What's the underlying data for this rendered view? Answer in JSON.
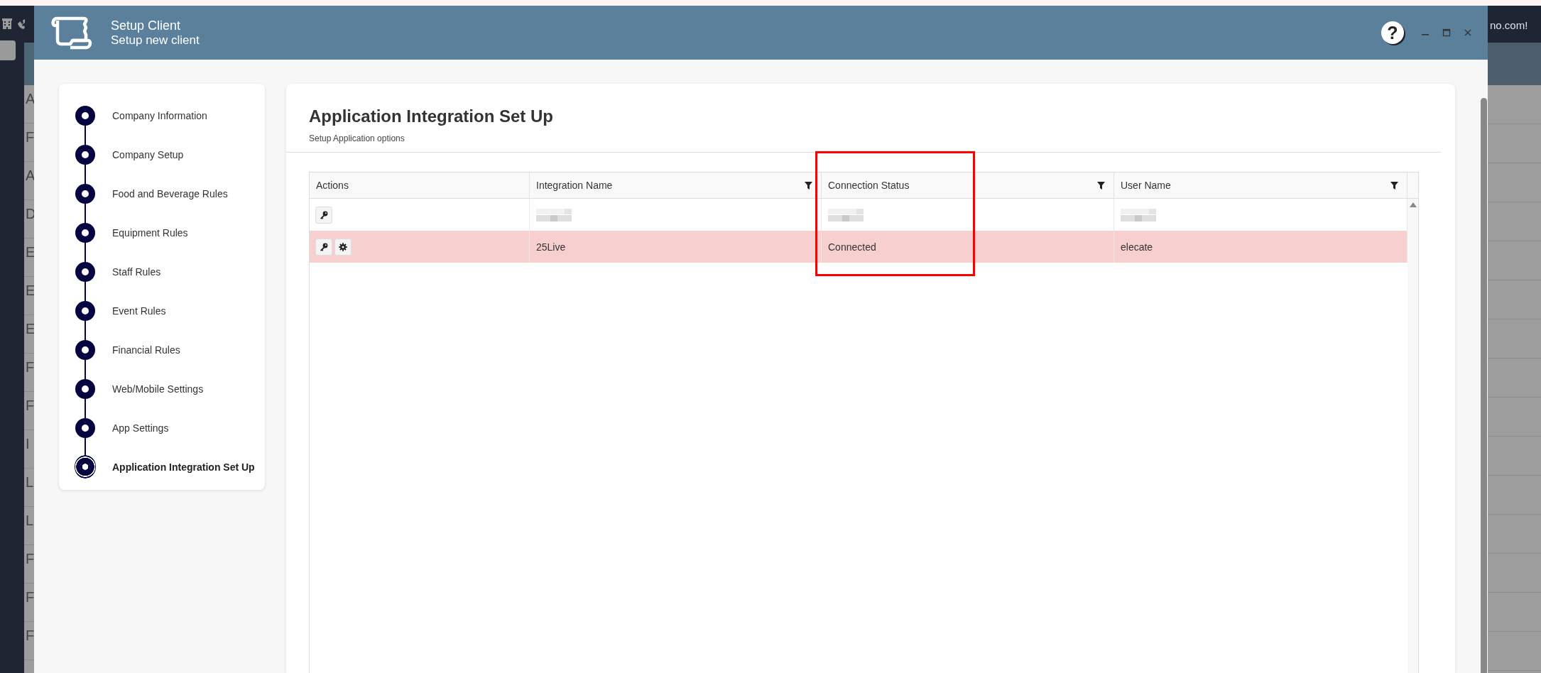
{
  "background": {
    "list_letters": [
      "A",
      "F",
      "A",
      "D",
      "E",
      "E",
      "E",
      "F",
      "F",
      "I",
      "L",
      "L",
      "F",
      "F",
      "F"
    ],
    "top_right_text": "no.com!"
  },
  "window": {
    "title": "Setup Client",
    "subtitle": "Setup new client",
    "help": "?"
  },
  "steps": [
    {
      "label": "Company Information",
      "selected": false
    },
    {
      "label": "Company Setup",
      "selected": false
    },
    {
      "label": "Food and Beverage Rules",
      "selected": false
    },
    {
      "label": "Equipment Rules",
      "selected": false
    },
    {
      "label": "Staff Rules",
      "selected": false
    },
    {
      "label": "Event Rules",
      "selected": false
    },
    {
      "label": "Financial Rules",
      "selected": false
    },
    {
      "label": "Web/Mobile Settings",
      "selected": false
    },
    {
      "label": "App Settings",
      "selected": false
    },
    {
      "label": "Application Integration Set Up",
      "selected": true
    }
  ],
  "page": {
    "title": "Application Integration Set Up",
    "subtitle": "Setup Application options"
  },
  "table": {
    "columns": [
      {
        "label": "Actions",
        "filter": false,
        "highlighted": false
      },
      {
        "label": "Integration Name",
        "filter": true,
        "highlighted": false
      },
      {
        "label": "Connection Status",
        "filter": true,
        "highlighted": true
      },
      {
        "label": "User Name",
        "filter": true,
        "highlighted": false
      }
    ],
    "rows": [
      {
        "selected": false,
        "cells": [
          {
            "actions": [
              {
                "kind": "key"
              }
            ]
          },
          {
            "redacted": true
          },
          {
            "redacted": true
          },
          {
            "redacted": true
          }
        ]
      },
      {
        "selected": true,
        "cells": [
          {
            "actions": [
              {
                "kind": "key"
              },
              {
                "kind": "gear"
              }
            ]
          },
          {
            "text": "25Live"
          },
          {
            "text": "Connected"
          },
          {
            "text": "elecate"
          }
        ]
      }
    ]
  }
}
